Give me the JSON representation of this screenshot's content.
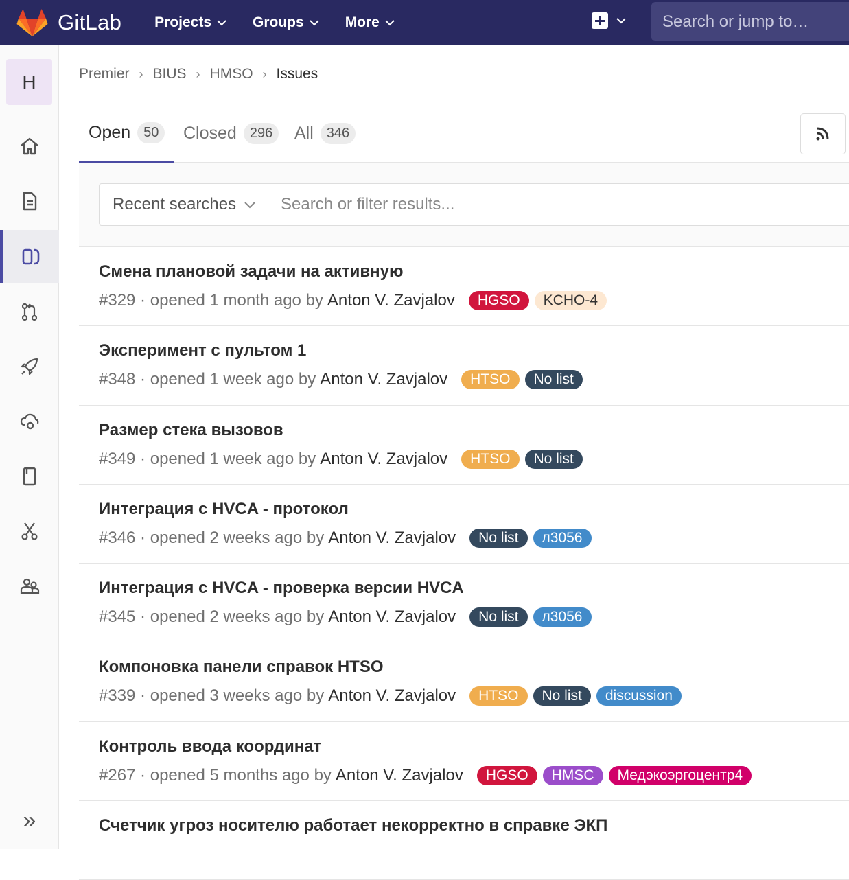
{
  "navbar": {
    "brand": "GitLab",
    "menu": [
      "Projects",
      "Groups",
      "More"
    ],
    "search_placeholder": "Search or jump to…"
  },
  "sidebar": {
    "avatar_letter": "H",
    "icons": [
      "home-icon",
      "document-icon",
      "issues-icon",
      "merge-request-icon",
      "rocket-icon",
      "cloud-gear-icon",
      "book-icon",
      "scissors-icon",
      "members-icon"
    ],
    "active": "issues-icon",
    "collapse_label": "»"
  },
  "breadcrumb": [
    "Premier",
    "BIUS",
    "HMSO",
    "Issues"
  ],
  "tabs": [
    {
      "label": "Open",
      "count": "50"
    },
    {
      "label": "Closed",
      "count": "296"
    },
    {
      "label": "All",
      "count": "346"
    }
  ],
  "filter": {
    "recent_label": "Recent searches",
    "placeholder": "Search or filter results..."
  },
  "issues": [
    {
      "title": "Смена плановой задачи на активную",
      "meta": "#329 · opened 1 month ago by",
      "author": "Anton V. Zavjalov",
      "labels": [
        {
          "text": "HGSO",
          "bg": "#d1153d",
          "fg": "#ffffff"
        },
        {
          "text": "KCHO-4",
          "bg": "#fde8d2",
          "fg": "#333333"
        }
      ]
    },
    {
      "title": "Эксперимент с пультом 1",
      "meta": "#348 · opened 1 week ago by",
      "author": "Anton V. Zavjalov",
      "labels": [
        {
          "text": "HTSO",
          "bg": "#f0ad4e",
          "fg": "#ffffff"
        },
        {
          "text": "No list",
          "bg": "#34495e",
          "fg": "#ffffff"
        }
      ]
    },
    {
      "title": "Размер стека вызовов",
      "meta": "#349 · opened 1 week ago by",
      "author": "Anton V. Zavjalov",
      "labels": [
        {
          "text": "HTSO",
          "bg": "#f0ad4e",
          "fg": "#ffffff"
        },
        {
          "text": "No list",
          "bg": "#34495e",
          "fg": "#ffffff"
        }
      ]
    },
    {
      "title": "Интеграция с HVCA - протокол",
      "meta": "#346 · opened 2 weeks ago by",
      "author": "Anton V. Zavjalov",
      "labels": [
        {
          "text": "No list",
          "bg": "#34495e",
          "fg": "#ffffff"
        },
        {
          "text": "л3056",
          "bg": "#428bca",
          "fg": "#ffffff"
        }
      ]
    },
    {
      "title": "Интеграция с HVCA - проверка версии HVCA",
      "meta": "#345 · opened 2 weeks ago by",
      "author": "Anton V. Zavjalov",
      "labels": [
        {
          "text": "No list",
          "bg": "#34495e",
          "fg": "#ffffff"
        },
        {
          "text": "л3056",
          "bg": "#428bca",
          "fg": "#ffffff"
        }
      ]
    },
    {
      "title": "Компоновка панели справок HTSO",
      "meta": "#339 · opened 3 weeks ago by",
      "author": "Anton V. Zavjalov",
      "labels": [
        {
          "text": "HTSO",
          "bg": "#f0ad4e",
          "fg": "#ffffff"
        },
        {
          "text": "No list",
          "bg": "#34495e",
          "fg": "#ffffff"
        },
        {
          "text": "discussion",
          "bg": "#428bca",
          "fg": "#ffffff"
        }
      ]
    },
    {
      "title": "Контроль ввода координат",
      "meta": "#267 · opened 5 months ago by",
      "author": "Anton V. Zavjalov",
      "labels": [
        {
          "text": "HGSO",
          "bg": "#d1153d",
          "fg": "#ffffff"
        },
        {
          "text": "HMSC",
          "bg": "#9b4dca",
          "fg": "#ffffff"
        },
        {
          "text": "Медэкоэргоцентр4",
          "bg": "#d10069",
          "fg": "#ffffff"
        }
      ]
    },
    {
      "title": "Счетчик угроз носителю работает некорректно в справке ЭКП",
      "meta": "",
      "author": "",
      "labels": []
    }
  ]
}
